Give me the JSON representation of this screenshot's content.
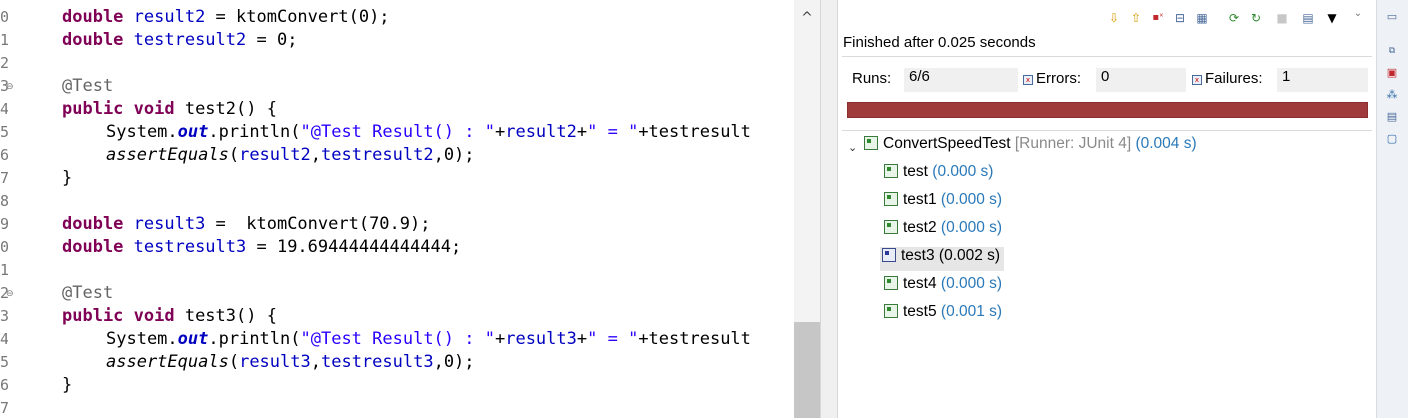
{
  "editor": {
    "line_numbers": [
      "0",
      "1",
      "2",
      "3",
      "4",
      "5",
      "6",
      "7",
      "8",
      "9",
      "0",
      "1",
      "2",
      "3",
      "4",
      "5",
      "6",
      "7"
    ],
    "fold_markers": [
      "⊖",
      "⊖"
    ],
    "code": {
      "l1": {
        "kw": "double ",
        "fld": "result2",
        "rest": " = ktomConvert(0);"
      },
      "l2": {
        "kw": "double ",
        "fld": "testresult2",
        "rest": " = 0;"
      },
      "l4": {
        "ann": "@Test"
      },
      "l5": {
        "kw": "public void ",
        "rest": "test2() {"
      },
      "l6": {
        "a": "System.",
        "stat": "out",
        "b": ".println(",
        "str": "\"@Test Result() : \"",
        "c": "+",
        "fld": "result2",
        "d": "+",
        "str2": "\" = \"",
        "e": "+testresult"
      },
      "l7": {
        "ital": "assertEquals",
        "a": "(",
        "fld": "result2",
        "b": ",",
        "fld2": "testresult2",
        "c": ",0);"
      },
      "l8": {
        "rest": "}"
      },
      "l10": {
        "kw": "double ",
        "fld": "result3",
        "rest": " =  ktomConvert(70.9);"
      },
      "l11": {
        "kw": "double ",
        "fld": "testresult3",
        "rest": " = 19.69444444444444;"
      },
      "l13": {
        "ann": "@Test"
      },
      "l14": {
        "kw": "public void ",
        "rest": "test3() {"
      },
      "l15": {
        "a": "System.",
        "stat": "out",
        "b": ".println(",
        "str": "\"@Test Result() : \"",
        "c": "+",
        "fld": "result3",
        "d": "+",
        "str2": "\" = \"",
        "e": "+testresult"
      },
      "l16": {
        "ital": "assertEquals",
        "a": "(",
        "fld": "result3",
        "b": ",",
        "fld2": "testresult3",
        "c": ",0);"
      },
      "l17": {
        "rest": "}"
      }
    },
    "scroll_up_glyph": "^"
  },
  "junit": {
    "toolbar_icons": [
      "next-failure-icon",
      "previous-failure-icon",
      "show-failures-only-icon",
      "scroll-lock-icon",
      "show-skipped-icon",
      "rerun-test-icon",
      "rerun-failed-first-icon",
      "stop-icon",
      "test-run-history-icon",
      "view-menu-icon",
      "minimize-icon"
    ],
    "status": "Finished after 0.025 seconds",
    "runs_label": "Runs:",
    "runs_value": "6/6",
    "errors_label": "Errors:",
    "errors_value": "0",
    "failures_label": "Failures:",
    "failures_value": "1",
    "progress": 1.0,
    "progress_color": "#9f3b3b",
    "suite": {
      "name": "ConvertSpeedTest",
      "runner": "[Runner: JUnit 4]",
      "time": "(0.004 s)"
    },
    "tests": [
      {
        "name": "test",
        "time": "(0.000 s)",
        "status": "pass"
      },
      {
        "name": "test1",
        "time": "(0.000 s)",
        "status": "pass"
      },
      {
        "name": "test2",
        "time": "(0.000 s)",
        "status": "pass"
      },
      {
        "name": "test3",
        "time": "(0.002 s)",
        "status": "fail"
      },
      {
        "name": "test4",
        "time": "(0.000 s)",
        "status": "pass"
      },
      {
        "name": "test5",
        "time": "(0.001 s)",
        "status": "pass"
      }
    ]
  },
  "right_trim": {
    "icons": [
      "restore-icon",
      "junit-icon",
      "hierarchy-icon",
      "outline-icon",
      "console-icon"
    ]
  }
}
